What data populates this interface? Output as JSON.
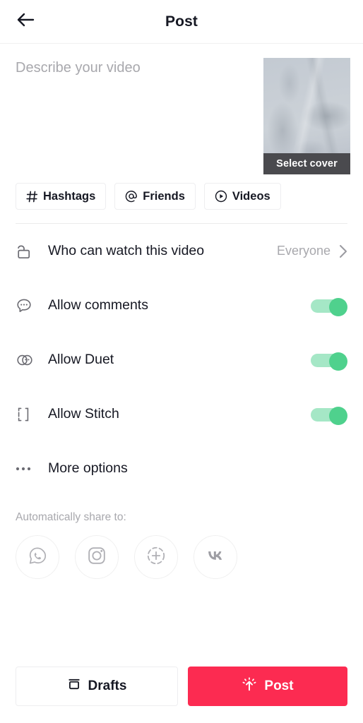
{
  "header": {
    "title": "Post",
    "back_icon": "arrow-left-icon"
  },
  "compose": {
    "description_value": "",
    "description_placeholder": "Describe your video",
    "cover": {
      "select_cover_label": "Select cover",
      "bar_color": "#4a4a4e"
    }
  },
  "chips": [
    {
      "label": "Hashtags",
      "icon": "hashtag-icon",
      "name": "chip-hashtags"
    },
    {
      "label": "Friends",
      "icon": "at-mention-icon",
      "name": "chip-friends"
    },
    {
      "label": "Videos",
      "icon": "play-circle-icon",
      "name": "chip-videos"
    }
  ],
  "options": [
    {
      "label": "Who can watch this video",
      "value": "Everyone",
      "icon": "unlock-icon",
      "control": "chevron"
    },
    {
      "label": "Allow comments",
      "icon": "comment-bubble-icon",
      "control": "toggle",
      "toggle_on": true
    },
    {
      "label": "Allow Duet",
      "icon": "duet-icon",
      "control": "toggle",
      "toggle_on": true
    },
    {
      "label": "Allow Stitch",
      "icon": "stitch-icon",
      "control": "toggle",
      "toggle_on": true
    },
    {
      "label": "More options",
      "icon": "ellipsis-icon",
      "control": "none"
    }
  ],
  "share": {
    "title": "Automatically share to:",
    "icons": [
      {
        "name": "whatsapp-icon",
        "label": "WhatsApp"
      },
      {
        "name": "instagram-icon",
        "label": "Instagram"
      },
      {
        "name": "instagram-story-icon",
        "label": "Instagram Story"
      },
      {
        "name": "vk-icon",
        "label": "VK"
      }
    ]
  },
  "footer": {
    "drafts_label": "Drafts",
    "post_label": "Post"
  },
  "colors": {
    "accent_red": "#fc2b51",
    "toggle_track": "#a5e7c6",
    "toggle_knob": "#4fd18d",
    "text_primary": "#161823",
    "text_muted": "#a8a8ad"
  }
}
